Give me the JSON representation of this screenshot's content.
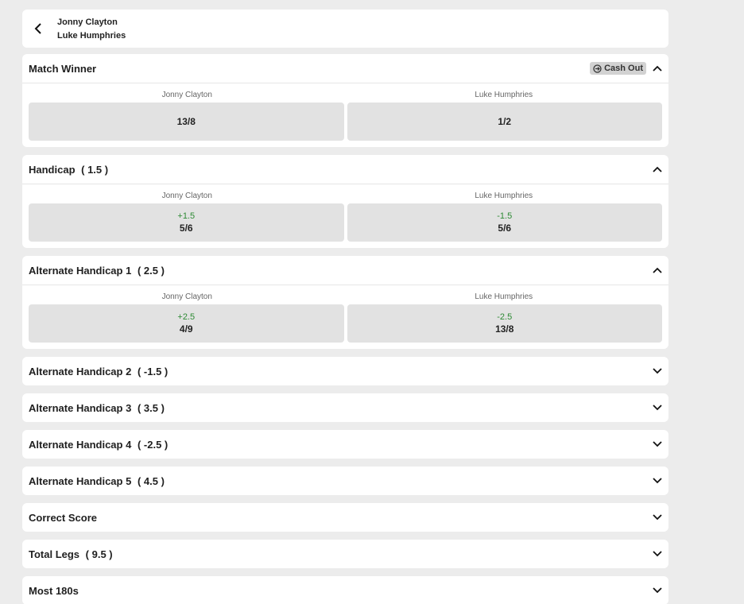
{
  "header": {
    "team_home": "Jonny Clayton",
    "team_away": "Luke Humphries"
  },
  "markets": [
    {
      "title": "Match Winner",
      "line": "",
      "cash_out": "Cash Out",
      "home_label": "Jonny Clayton",
      "away_label": "Luke Humphries",
      "home": {
        "handicap": "",
        "odds": "13/8"
      },
      "away": {
        "handicap": "",
        "odds": "1/2"
      }
    },
    {
      "title": "Handicap",
      "line": "( 1.5 )",
      "home_label": "Jonny Clayton",
      "away_label": "Luke Humphries",
      "home": {
        "handicap": "+1.5",
        "odds": "5/6"
      },
      "away": {
        "handicap": "-1.5",
        "odds": "5/6"
      }
    },
    {
      "title": "Alternate Handicap 1",
      "line": "( 2.5 )",
      "home_label": "Jonny Clayton",
      "away_label": "Luke Humphries",
      "home": {
        "handicap": "+2.5",
        "odds": "4/9"
      },
      "away": {
        "handicap": "-2.5",
        "odds": "13/8"
      }
    }
  ],
  "collapsed_markets": [
    {
      "title": "Alternate Handicap 2",
      "line": "( -1.5 )"
    },
    {
      "title": "Alternate Handicap 3",
      "line": "( 3.5 )"
    },
    {
      "title": "Alternate Handicap 4",
      "line": "( -2.5 )"
    },
    {
      "title": "Alternate Handicap 5",
      "line": "( 4.5 )"
    },
    {
      "title": "Correct Score",
      "line": ""
    },
    {
      "title": "Total Legs",
      "line": "( 9.5 )"
    },
    {
      "title": "Most 180s",
      "line": ""
    }
  ],
  "icons": {
    "back": "chevron-left-icon",
    "expanded": "chevron-up-icon",
    "collapsed": "chevron-down-icon",
    "cash_out": "cash-out-icon"
  },
  "colors": {
    "background": "#ececec",
    "card": "#ffffff",
    "selection": "#e2e2e2",
    "handicap_text": "#2d8a34"
  }
}
